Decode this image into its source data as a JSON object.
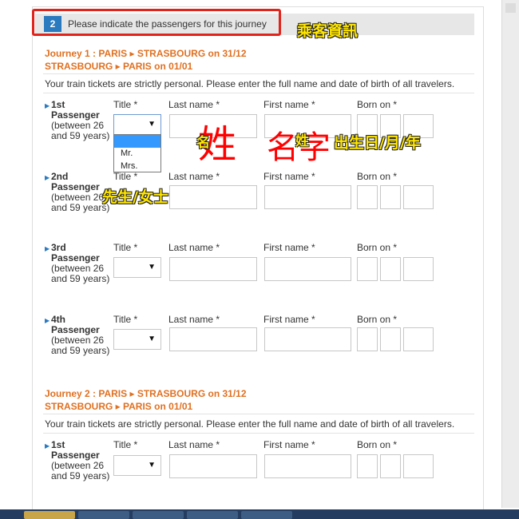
{
  "step": {
    "number": "2",
    "title": "Please indicate the passengers for this journey"
  },
  "annotations": {
    "passenger_info": "乘客資訊",
    "surname": "姓",
    "given_name": "名字",
    "given_prefix": "名",
    "surname_small": "姓",
    "birth_date": "出生日/月/年",
    "title_note": "先生/女士"
  },
  "journeys": [
    {
      "line1": "Journey 1 : PARIS ▸ STRASBOURG on 31/12",
      "line2": "STRASBOURG ▸ PARIS on 01/01"
    },
    {
      "line1": "Journey 2 : PARIS ▸ STRASBOURG on 31/12",
      "line2": "STRASBOURG ▸ PARIS on 01/01"
    }
  ],
  "notice": "Your train tickets are strictly personal. Please enter the full name and date of birth of all travelers.",
  "fields": {
    "title": "Title *",
    "last_name": "Last name *",
    "first_name": "First name *",
    "born_on": "Born on *"
  },
  "passengers": [
    {
      "line1": "1st",
      "line2": "Passenger",
      "sub": "(between 26 and 59 years)"
    },
    {
      "line1": "2nd",
      "line2": "Passenger",
      "sub": "(between 26 and 59 years)"
    },
    {
      "line1": "3rd",
      "line2": "Passenger",
      "sub": "(between 26 and 59 years)"
    },
    {
      "line1": "4th",
      "line2": "Passenger",
      "sub": "(between 26 and 59 years)"
    },
    {
      "line1": "1st",
      "line2": "Passenger",
      "sub": "(between 26 and 59 years)"
    }
  ],
  "title_options": [
    "",
    "Mr.",
    "Mrs."
  ],
  "icons": {
    "select_caret": "caret-down-icon",
    "bullet": "triangle-right-icon"
  },
  "colors": {
    "accent": "#2a7abf",
    "journey": "#e07020",
    "highlight_frame": "#e0241b",
    "annotation": "#ffe600"
  }
}
